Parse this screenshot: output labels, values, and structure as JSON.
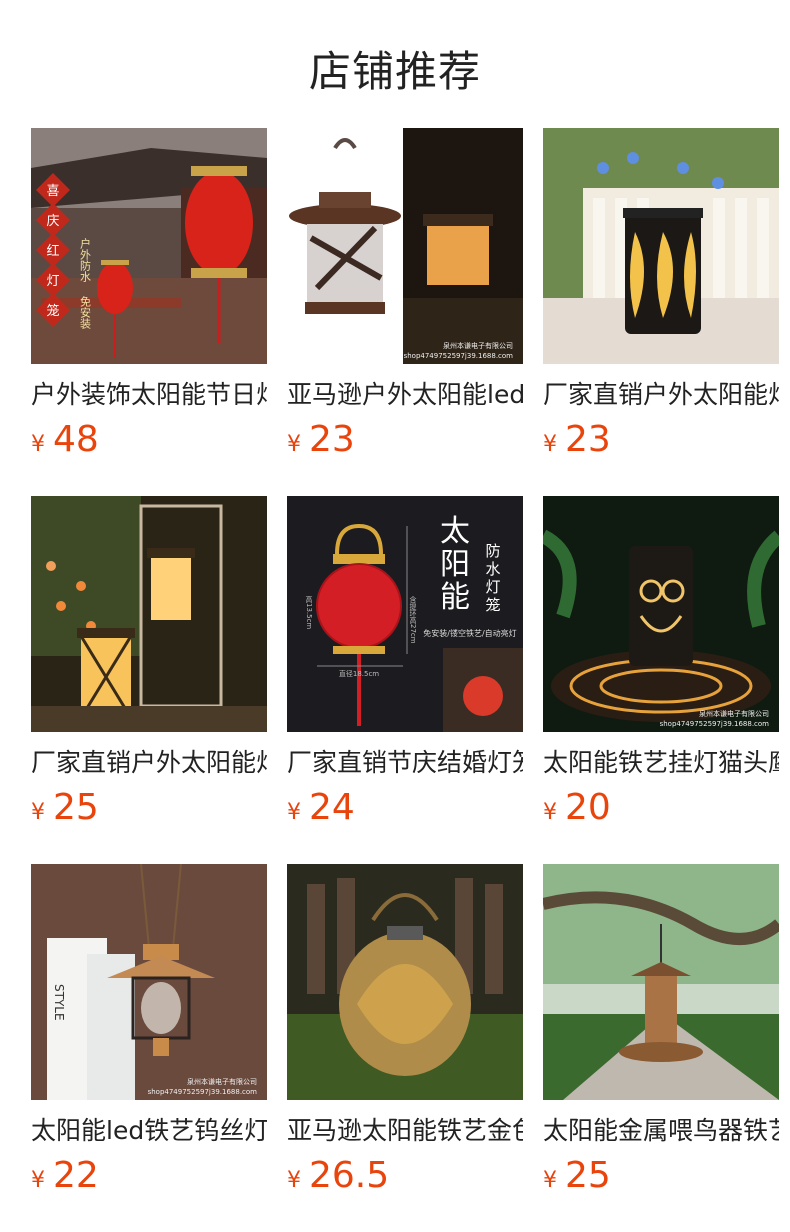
{
  "header": {
    "title": "店铺推荐"
  },
  "currency": "¥",
  "products": [
    {
      "name": "户外装饰太阳能节日灯笼",
      "price": "48",
      "image": "red-lantern-chinese-building"
    },
    {
      "name": "亚马逊户外太阳能led灯笼",
      "price": "23",
      "image": "bronze-lantern-dragonfly"
    },
    {
      "name": "厂家直销户外太阳能灯笼",
      "price": "23",
      "image": "black-lantern-leaf-pattern"
    },
    {
      "name": "厂家直销户外太阳能灯笼",
      "price": "25",
      "image": "glowing-lanterns-garden"
    },
    {
      "name": "厂家直销节庆结婚灯笼",
      "price": "24",
      "image": "red-hollow-lantern-banner"
    },
    {
      "name": "太阳能铁艺挂灯猫头鹰",
      "price": "20",
      "image": "owl-lantern-night"
    },
    {
      "name": "太阳能led铁艺钨丝灯",
      "price": "22",
      "image": "copper-filament-lantern"
    },
    {
      "name": "亚马逊太阳能铁艺金色灯笼",
      "price": "26.5",
      "image": "gold-moroccan-lantern"
    },
    {
      "name": "太阳能金属喂鸟器铁艺",
      "price": "25",
      "image": "bird-feeder-tree"
    }
  ],
  "image_text": {
    "lantern_vertical": [
      "喜",
      "庆",
      "红",
      "灯",
      "笼"
    ],
    "lantern_side1": "户外防水",
    "lantern_side2": "免安装",
    "watermark_company": "泉州本谦电子有限公司",
    "watermark_shop": "shop4749752597j39.1688.com",
    "banner_big": [
      "太",
      "阳",
      "能"
    ],
    "banner_small": [
      "防",
      "水",
      "灯",
      "笼"
    ],
    "banner_caption": "免安装/镂空铁艺/自动亮灯",
    "dim_height": "含提环高27cm",
    "dim_body": "高13.5cm",
    "dim_diameter": "直径18.5cm",
    "book_spine": "STYLE"
  }
}
